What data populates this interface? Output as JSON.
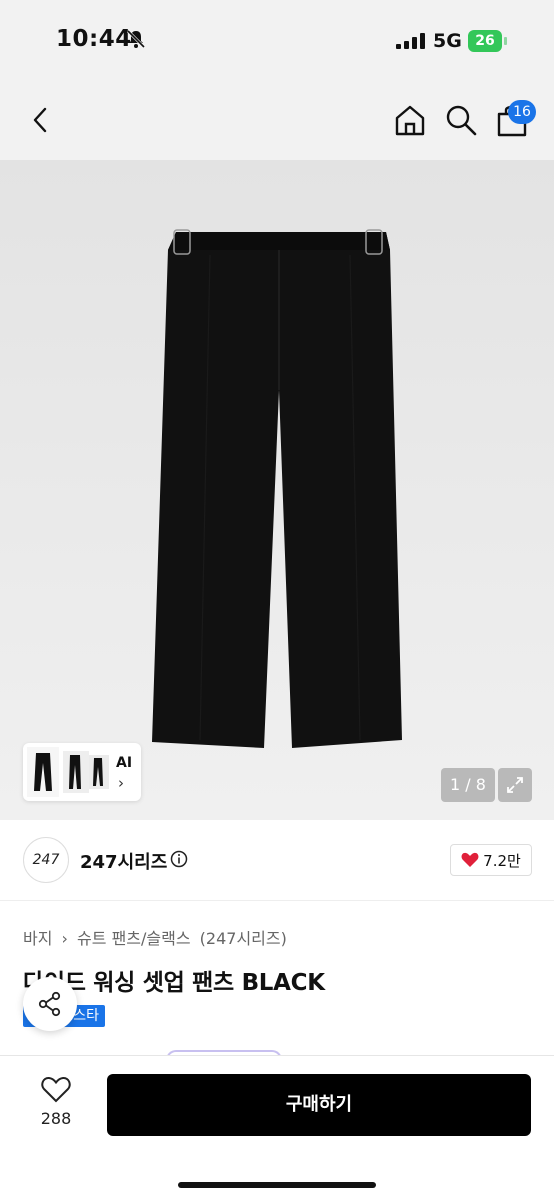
{
  "status_bar": {
    "time": "10:44",
    "network": "5G",
    "battery": "26"
  },
  "header": {
    "cart_count": "16"
  },
  "gallery": {
    "ai_label": "AI",
    "ai_chevron": "›",
    "pager": "1 / 8"
  },
  "brand": {
    "logo_text": "247",
    "name": "247시리즈"
  },
  "likes": {
    "count": "7.2만"
  },
  "breadcrumb": {
    "items": [
      "바지",
      "›",
      "슈트 팬츠/슬랙스",
      "(247시리즈)"
    ]
  },
  "product": {
    "title": "다이드 워싱 셋업 팬츠 BLACK",
    "tag": "스타"
  },
  "bottom": {
    "wish_count": "288",
    "buy_label": "구매하기"
  },
  "colors": {
    "accent": "#1a74e8",
    "buy_button": "#000000",
    "heart": "#e0203a",
    "battery": "#33c759"
  }
}
